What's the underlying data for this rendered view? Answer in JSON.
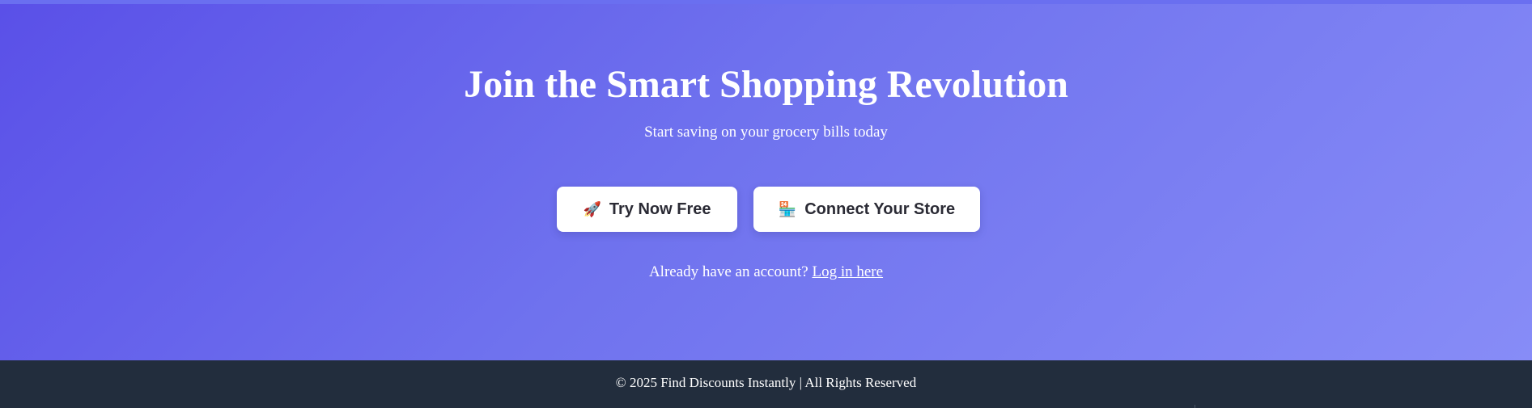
{
  "hero": {
    "title": "Join the Smart Shopping Revolution",
    "subtitle": "Start saving on your grocery bills today",
    "background_start": "#5a50e8",
    "background_end": "#878cf7"
  },
  "cta": {
    "try_now": {
      "icon": "rocket-icon",
      "glyph": "🚀",
      "label": "Try Now Free"
    },
    "connect_store": {
      "icon": "store-icon",
      "glyph": "🏪",
      "label": "Connect Your Store"
    }
  },
  "login": {
    "prompt": "Already have an account?",
    "link_label": "Log in here"
  },
  "footer": {
    "text": "© 2025 Find Discounts Instantly | All Rights Reserved",
    "background": "#222d3d"
  }
}
